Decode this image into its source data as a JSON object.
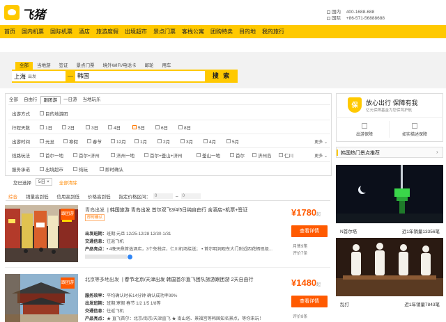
{
  "brand": {
    "name": "飞猪"
  },
  "contact": {
    "domestic_label": "国内",
    "domestic_phone": "400-1688-688",
    "intl_label": "国际",
    "intl_phone": "+86-571-56888688"
  },
  "nav": [
    "首页",
    "国内机票",
    "国际机票",
    "酒店",
    "旅游度假",
    "出境超市",
    "景点门票",
    "客栈公寓",
    "团购特卖",
    "目的地",
    "我的旅行"
  ],
  "search": {
    "tabs": [
      "全部",
      "当地游",
      "签证",
      "景点门票",
      "境外WIFI/电话卡",
      "邮轮",
      "用车"
    ],
    "active_tab": "全部",
    "from_city": "上海",
    "from_sub": "出发",
    "to_city": "韩国",
    "button": "搜 索"
  },
  "filter": {
    "sub_tabs": [
      "全部",
      "自由行",
      "跟团游",
      "一日游",
      "当地玩乐"
    ],
    "active_sub_tab": "跟团游",
    "rows": [
      {
        "label": "出游方式",
        "options": [
          {
            "text": "目的地游团",
            "checked": false
          }
        ],
        "more": ""
      },
      {
        "label": "行程天数",
        "options": [
          {
            "text": "1日",
            "checked": false
          },
          {
            "text": "2日",
            "checked": false
          },
          {
            "text": "3日",
            "checked": false
          },
          {
            "text": "4日",
            "checked": false
          },
          {
            "text": "5日",
            "checked": true
          },
          {
            "text": "6日",
            "checked": false
          },
          {
            "text": "8日",
            "checked": false
          }
        ],
        "more": ""
      },
      {
        "label": "出游时间",
        "options": [
          {
            "text": "元旦",
            "checked": false
          },
          {
            "text": "寒假",
            "checked": false
          },
          {
            "text": "春节",
            "checked": false
          },
          {
            "text": "12月",
            "checked": false
          },
          {
            "text": "1月",
            "checked": false
          },
          {
            "text": "2月",
            "checked": false
          },
          {
            "text": "3月",
            "checked": false
          },
          {
            "text": "4月",
            "checked": false
          },
          {
            "text": "5月",
            "checked": false
          }
        ],
        "more": "更多"
      },
      {
        "label": "线路玩法",
        "options": [
          {
            "text": "首尔一地",
            "checked": false
          },
          {
            "text": "首尔+济州",
            "checked": false
          },
          {
            "text": "济州一地",
            "checked": false
          },
          {
            "text": "首尔+釜山+济州",
            "checked": false
          },
          {
            "text": "釜山一地",
            "checked": false
          },
          {
            "text": "首尔",
            "checked": false
          },
          {
            "text": "济州岛",
            "checked": false
          },
          {
            "text": "仁川",
            "checked": false
          }
        ],
        "more": "更多"
      },
      {
        "label": "服务承诺",
        "options": [
          {
            "text": "出境超市",
            "checked": false
          },
          {
            "text": "纯玩",
            "checked": false
          },
          {
            "text": "即时确认",
            "checked": false
          }
        ],
        "more": ""
      }
    ]
  },
  "chosen": {
    "label": "您已选择",
    "tag": "5日",
    "tag_close": "×",
    "clear": "全部清除"
  },
  "sortbar": {
    "items": [
      "综合",
      "销量高到低",
      "信用高到低",
      "价格高到低"
    ],
    "active": "综合",
    "price_label": "指定价格区间：",
    "min_placeholder": "0",
    "max_placeholder": "0"
  },
  "products": [
    {
      "badge": "跟团游",
      "departure": "青岛出发",
      "title": "| 韩国旅游 青岛出发 首尔双飞3/4/5日纯自由行 含酒店+机票+签证",
      "tag": "即时确认",
      "lines": [
        {
          "label": "出发班期：",
          "text": "班期:元旦 12/25-12/28 12/30-1/31"
        },
        {
          "label": "交通信息：",
          "text": "往返飞机"
        },
        {
          "label": "产品亮点：",
          "text": "• 4晚天鼎首选酒店，3个免税店，仁川机场接送； • 首尔明洞观东大门附近四花栖现级..."
        }
      ],
      "price": "¥1780",
      "price_suffix": "起",
      "button": "查看详情",
      "sold": "月售9笔",
      "reviews": "评价7条"
    },
    {
      "badge": "跟团游",
      "departure": "北京等多地出发",
      "title": "| 春节北京/天津出发 韩国首尔直飞团队旅游跟团游 2天自由行",
      "tag": "",
      "lines": [
        {
          "label": "服务效率：",
          "text": "平均确认时长14分钟 确认成功率99%"
        },
        {
          "label": "出发班期：",
          "text": "班期:寒假 春节 1/2 1/5 1/8等"
        },
        {
          "label": "交通信息：",
          "text": "往返飞机"
        },
        {
          "label": "产品亮点：",
          "text": "★ 直飞首尔：北京/南京/天津直飞 ★ 南山塔、景福宫等韩国知名景点，等你来玩！"
        }
      ],
      "price": "¥1480",
      "price_suffix": "起",
      "button": "查看详情",
      "sold": "",
      "reviews": "评价8条"
    }
  ],
  "guarantee": {
    "icon": "保",
    "title": "放心出行 保障有我",
    "subtitle": "亿元保障基金为您保驾护航",
    "items": [
      "出游保障",
      "如实描述保障"
    ]
  },
  "spots": {
    "title": "韩国热门景点推荐",
    "arrow": "›",
    "items": [
      {
        "name": "N首尔塔",
        "sold_prefix": "近1年销量",
        "sold": "13356笔"
      },
      {
        "name": "乱打",
        "sold_prefix": "近1年销量",
        "sold": "7843笔"
      }
    ]
  },
  "colors": {
    "brand_yellow": "#ffc900",
    "accent_orange": "#ff5a00"
  }
}
